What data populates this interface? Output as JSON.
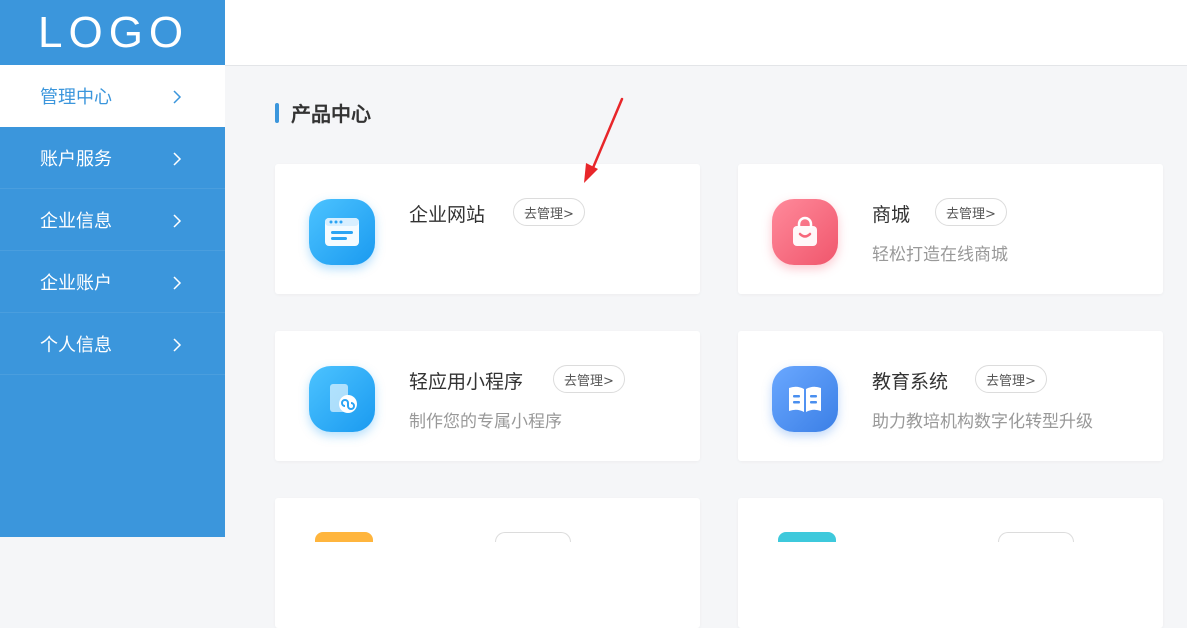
{
  "logo": "LOGO",
  "sidebar": {
    "items": [
      {
        "label": "管理中心",
        "active": true
      },
      {
        "label": "账户服务",
        "active": false
      },
      {
        "label": "企业信息",
        "active": false
      },
      {
        "label": "企业账户",
        "active": false
      },
      {
        "label": "个人信息",
        "active": false
      }
    ]
  },
  "section": {
    "title": "产品中心"
  },
  "products": [
    {
      "name": "企业网站",
      "manage": "去管理>",
      "desc": "",
      "icon": "website-icon",
      "color": "#2ba4f4"
    },
    {
      "name": "商城",
      "manage": "去管理>",
      "desc": "轻松打造在线商城",
      "icon": "shopping-bag-icon",
      "color": "#f7667a"
    },
    {
      "name": "轻应用小程序",
      "manage": "去管理>",
      "desc": "制作您的专属小程序",
      "icon": "mini-program-icon",
      "color": "#2ba4f4"
    },
    {
      "name": "教育系统",
      "manage": "去管理>",
      "desc": "助力教培机构数字化转型升级",
      "icon": "book-icon",
      "color": "#4a8fef"
    }
  ],
  "colors": {
    "accent": "#3b96dc",
    "annotation_arrow": "#e8262a"
  }
}
